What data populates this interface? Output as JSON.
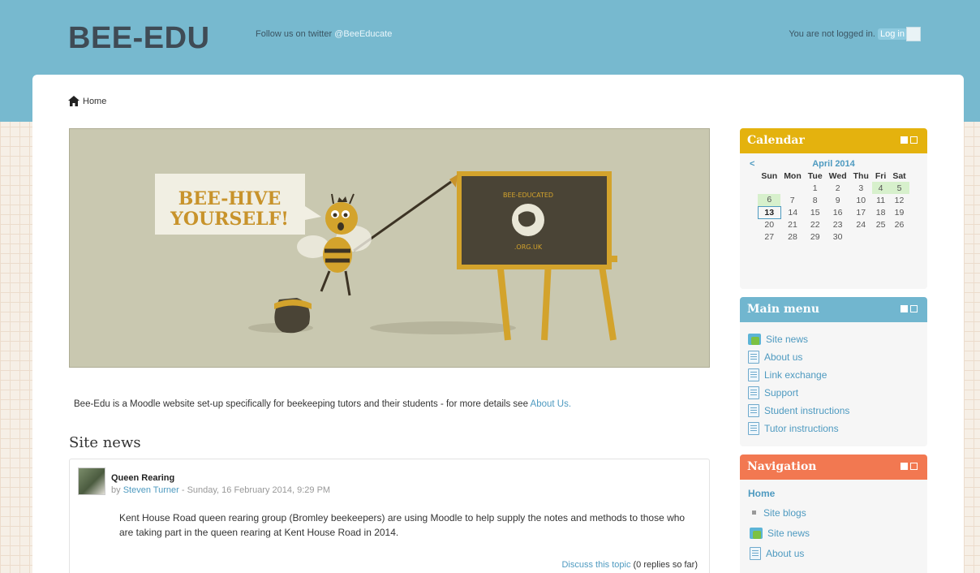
{
  "header": {
    "brand": "BEE-EDU",
    "follow_text": "Follow us on twitter",
    "twitter_handle": "@BeeEducate",
    "login_status": "You are not logged in.",
    "login_link": "Log in"
  },
  "breadcrumb": {
    "home": "Home"
  },
  "banner": {
    "speech_line1": "BEE-HIVE",
    "speech_line2": "YOURSELF!",
    "board_top": "BEE-EDUCATED",
    "board_bottom": ".ORG.UK"
  },
  "intro": {
    "text": "Bee-Edu is a Moodle website set-up specifically for beekeeping tutors and their students - for more details see",
    "link": "About Us."
  },
  "site_news": {
    "title": "Site news",
    "post": {
      "subject": "Queen Rearing",
      "by": "by",
      "author": "Steven Turner",
      "date": "- Sunday, 16 February 2014, 9:29 PM",
      "message": "Kent House Road queen rearing group (Bromley beekeepers) are using Moodle to help supply the notes and methods to those who are taking part in the queen rearing at Kent House Road in 2014.",
      "discuss_link": "Discuss this topic",
      "replies": "(0 replies so far)"
    }
  },
  "calendar": {
    "title": "Calendar",
    "prev": "<",
    "month": "April 2014",
    "days": [
      "Sun",
      "Mon",
      "Tue",
      "Wed",
      "Thu",
      "Fri",
      "Sat"
    ],
    "weeks": [
      [
        "",
        "",
        "1",
        "2",
        "3",
        "4",
        "5"
      ],
      [
        "6",
        "7",
        "8",
        "9",
        "10",
        "11",
        "12"
      ],
      [
        "13",
        "14",
        "15",
        "16",
        "17",
        "18",
        "19"
      ],
      [
        "20",
        "21",
        "22",
        "23",
        "24",
        "25",
        "26"
      ],
      [
        "27",
        "28",
        "29",
        "30",
        "",
        "",
        ""
      ]
    ],
    "weekend_highlight": [
      "4",
      "5",
      "6"
    ],
    "today": "13"
  },
  "main_menu": {
    "title": "Main menu",
    "items": [
      {
        "label": "Site news",
        "icon": "forum-icon"
      },
      {
        "label": "About us",
        "icon": "page-icon"
      },
      {
        "label": "Link exchange",
        "icon": "page-icon"
      },
      {
        "label": "Support",
        "icon": "page-icon"
      },
      {
        "label": "Student instructions",
        "icon": "page-icon"
      },
      {
        "label": "Tutor instructions",
        "icon": "page-icon"
      }
    ]
  },
  "navigation": {
    "title": "Navigation",
    "home": "Home",
    "items": [
      {
        "label": "Site blogs",
        "icon": "bullet-icon"
      },
      {
        "label": "Site news",
        "icon": "forum-icon"
      },
      {
        "label": "About us",
        "icon": "page-icon"
      }
    ]
  },
  "colors": {
    "header": "#77b9cf",
    "calendar": "#e4b20e",
    "main_menu": "#71b6cf",
    "navigation": "#f27851",
    "link": "#4e9ac0"
  }
}
